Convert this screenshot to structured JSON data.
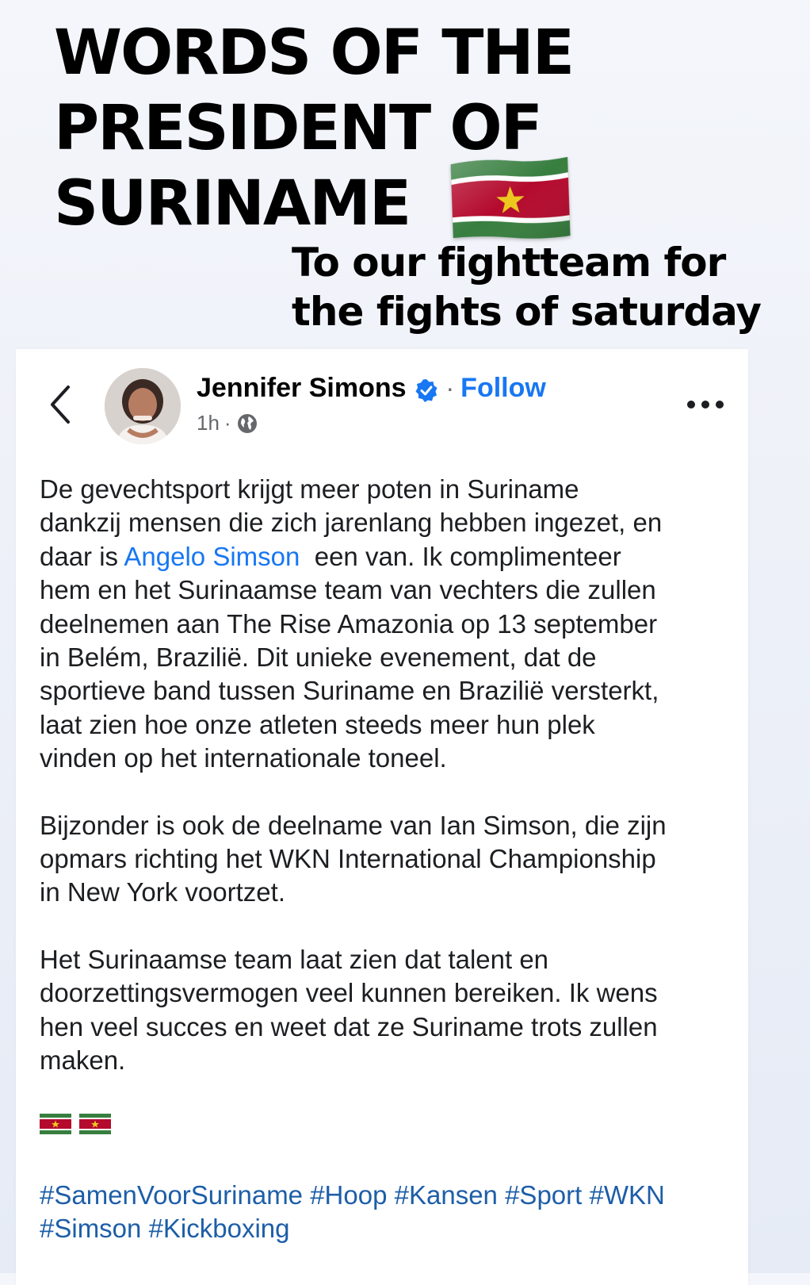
{
  "overlay": {
    "headline_lines": [
      "WORDS OF THE",
      "PRESIDENT OF",
      "SURINAME"
    ],
    "subheadline_lines": [
      "To our fightteam for",
      "the fights of saturday"
    ],
    "flag_icon": "suriname-flag-icon"
  },
  "post": {
    "author_name": "Jennifer Simons",
    "verified_icon": "verified-badge-icon",
    "separator": "·",
    "follow_label": "Follow",
    "time_ago": "1h",
    "meta_separator": "·",
    "audience_icon": "globe-icon",
    "back_icon": "chevron-left-icon",
    "more_icon": "more-dots-icon",
    "body": {
      "p1": {
        "l1": "De gevechtsport krijgt meer poten in Suriname",
        "l2": "dankzij mensen die zich jarenlang hebben ingezet, en",
        "l3_pre": "daar is ",
        "l3_mention": "Angelo Simson",
        "l3_post": "  een van. Ik complimenteer",
        "l4": "hem en het Surinaamse team van vechters die zullen",
        "l5": "deelnemen aan The Rise Amazonia op 13 september",
        "l6": "in Belém, Brazilië. Dit unieke evenement, dat de",
        "l7": "sportieve band tussen Suriname en Brazilië versterkt,",
        "l8": "laat zien hoe onze atleten steeds meer hun plek",
        "l9": "vinden op het internationale toneel."
      },
      "p2": {
        "l1": "Bijzonder is ook de deelname van Ian Simson, die zijn",
        "l2": "opmars richting het WKN International Championship",
        "l3": "in New York voortzet."
      },
      "p3": {
        "l1": "Het Surinaamse team laat zien dat talent en",
        "l2": "doorzettingsvermogen veel kunnen bereiken. Ik wens",
        "l3": "hen veel succes en weet dat ze Suriname trots zullen",
        "l4": "maken."
      }
    },
    "flag_emojis": [
      "suriname-flag-icon",
      "suriname-flag-icon"
    ],
    "hashtags_row1": [
      "#SamenVoorSuriname",
      "#Hoop",
      "#Kansen",
      "#Sport",
      "#WKN"
    ],
    "hashtags_row2": [
      "#Simson",
      "#Kickboxing"
    ]
  },
  "colors": {
    "link_blue": "#1877f2",
    "hashtag_blue": "#1d5ea8",
    "flag_green": "#377e3f",
    "flag_red": "#b40a2d",
    "flag_star": "#ecc81d"
  }
}
